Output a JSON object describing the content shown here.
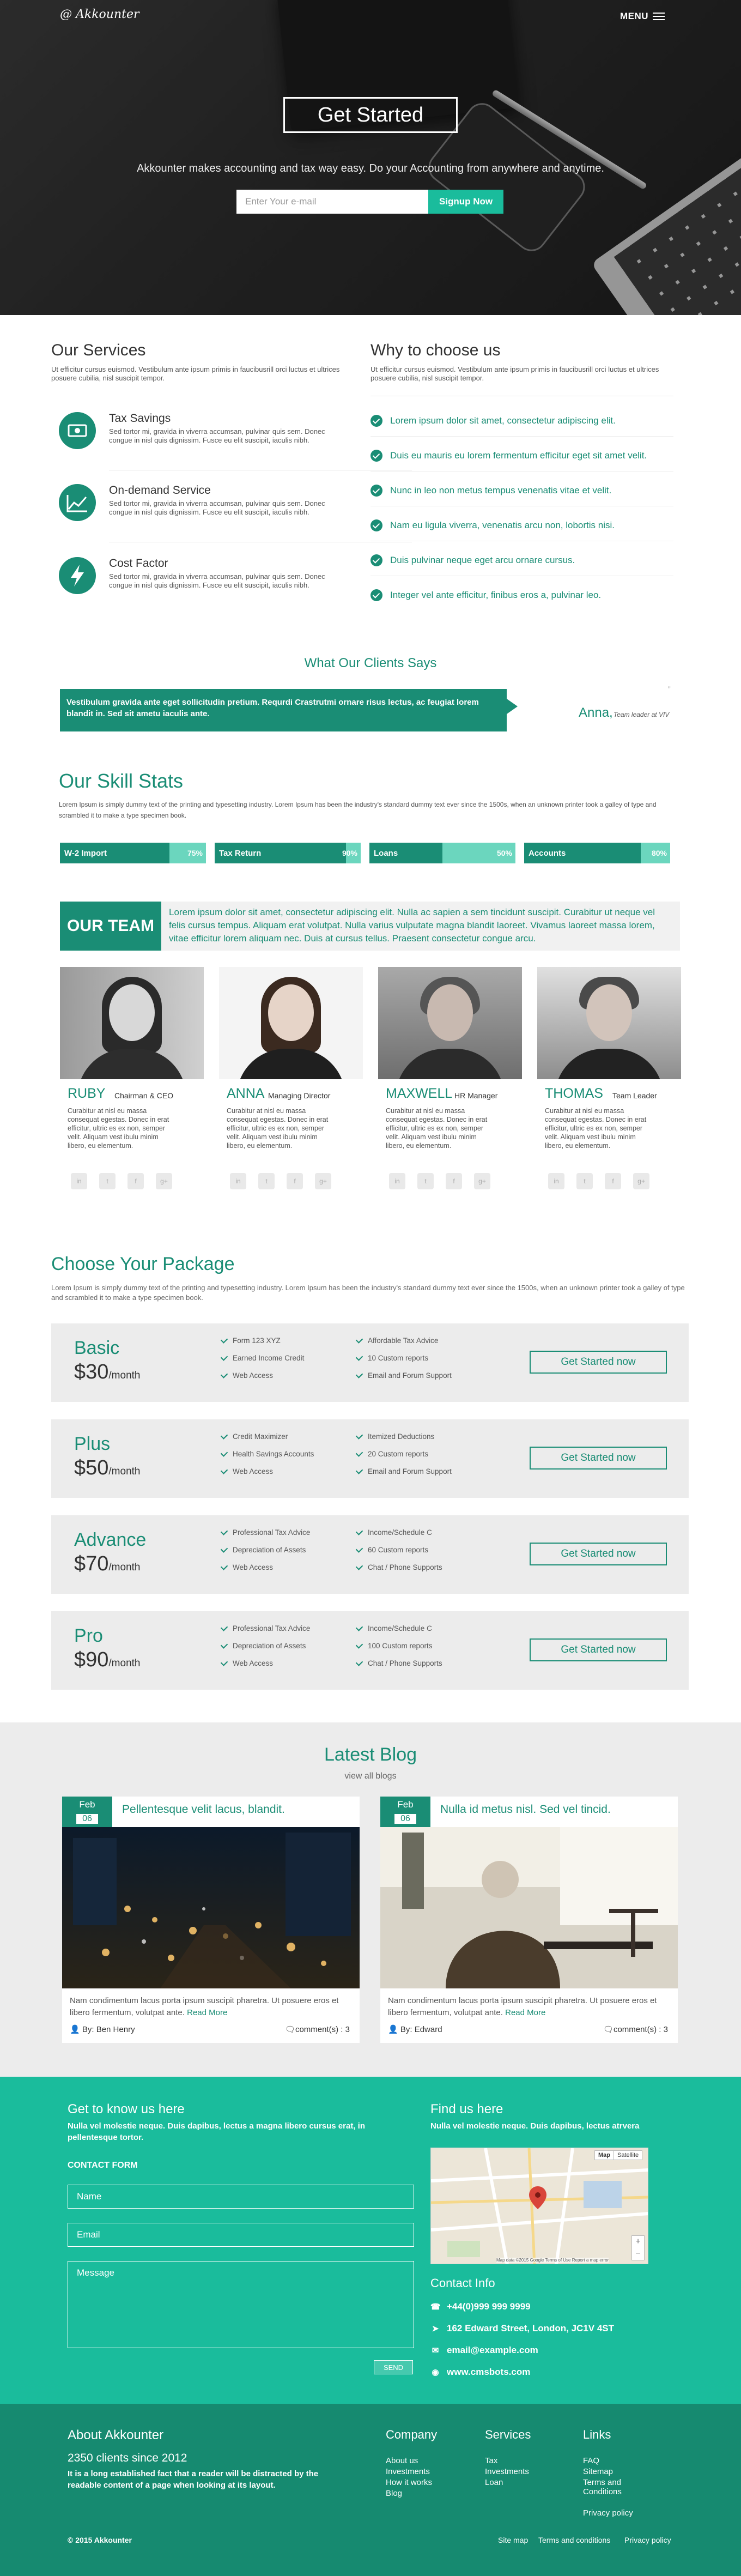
{
  "header": {
    "logo": "@ Akkounter",
    "menu_label": "MENU"
  },
  "hero": {
    "cta_label": "Get Started",
    "tagline": "Akkounter makes accounting and tax way easy. Do your Accounting from anywhere and anytime.",
    "email_placeholder": "Enter Your e-mail",
    "signup_label": "Signup Now"
  },
  "services": {
    "title": "Our Services",
    "intro": "Ut efficitur cursus euismod. Vestibulum ante ipsum primis in faucibusrill orci luctus et ultrices posuere cubilia, nisl suscipit tempor.",
    "items": [
      {
        "title": "Tax Savings",
        "icon": "money-icon",
        "text": "Sed tortor mi, gravida in viverra accumsan, pulvinar quis sem. Donec congue in nisl quis dignissim. Fusce eu elit suscipit, iaculis nibh."
      },
      {
        "title": "On-demand Service",
        "icon": "trend-chart-icon",
        "text": "Sed tortor mi, gravida in viverra accumsan, pulvinar quis sem. Donec congue in nisl quis dignissim. Fusce eu elit suscipit, iaculis nibh."
      },
      {
        "title": "Cost Factor",
        "icon": "lightning-icon",
        "text": "Sed tortor mi, gravida in viverra accumsan, pulvinar quis sem. Donec congue in nisl quis dignissim. Fusce eu elit suscipit, iaculis nibh."
      }
    ]
  },
  "why": {
    "title": "Why to choose us",
    "intro": "Ut efficitur cursus euismod. Vestibulum ante ipsum primis in faucibusrill orci luctus et ultrices posuere cubilia, nisl suscipit tempor.",
    "items": [
      "Lorem ipsum dolor sit amet, consectetur adipiscing elit.",
      "Duis eu mauris eu lorem fermentum efficitur eget sit amet velit.",
      "Nunc in leo non metus tempus venenatis vitae et velit.",
      "Nam eu ligula viverra, venenatis arcu non, lobortis nisi.",
      "Duis pulvinar neque eget arcu ornare cursus.",
      "Integer vel ante efficitur, finibus eros a, pulvinar leo."
    ]
  },
  "testimonial": {
    "title": "What Our Clients Says",
    "quote": "Vestibulum gravida ante eget sollicitudin pretium. Requrdi Crastrutmi ornare risus lectus, ac feugiat lorem blandit in. Sed sit ametu iaculis ante.",
    "name": "Anna,",
    "role": "Team leader at VIV",
    "quote_mark": "”"
  },
  "skills": {
    "title": "Our Skill Stats",
    "desc": "Lorem Ipsum is simply dummy text of the printing and typesetting industry. Lorem Ipsum has been the industry's standard dummy text ever since the 1500s, when an unknown printer took a galley of type and scrambled it to make a type specimen book.",
    "items": [
      {
        "label": "W-2 Import",
        "pct_label": "75%",
        "value": 0.75
      },
      {
        "label": "Tax Return",
        "pct_label": "90%",
        "value": 0.9
      },
      {
        "label": "Loans",
        "pct_label": "50%",
        "value": 0.5
      },
      {
        "label": "Accounts",
        "pct_label": "80%",
        "value": 0.8
      }
    ]
  },
  "team": {
    "badge": "OUR TEAM",
    "intro": "Lorem ipsum dolor sit amet, consectetur adipiscing elit. Nulla ac sapien a sem tincidunt suscipit. Curabitur ut neque vel felis cursus tempus. Aliquam erat volutpat. Nulla varius vulputate magna blandit laoreet. Vivamus laoreet massa lorem, vitae efficitur lorem aliquam nec. Duis at cursus tellus. Praesent consectetur congue arcu.",
    "members": [
      {
        "name": "RUBY",
        "role": "Chairman & CEO",
        "text": "Curabitur at nisl eu massa consequat egestas. Donec in erat efficitur, ultric es ex non, semper velit. Aliquam vest ibulu minim libero, eu elementum."
      },
      {
        "name": "ANNA",
        "role": "Managing Director",
        "text": "Curabitur at nisl eu massa consequat egestas. Donec in erat efficitur, ultric es ex non, semper velit. Aliquam vest ibulu minim libero, eu elementum."
      },
      {
        "name": "MAXWELL",
        "role": "HR Manager",
        "text": "Curabitur at nisl eu massa consequat egestas. Donec in erat efficitur, ultric es ex non, semper velit. Aliquam vest ibulu minim libero, eu elementum."
      },
      {
        "name": "THOMAS",
        "role": "Team Leader",
        "text": "Curabitur at nisl eu massa consequat egestas. Donec in erat efficitur, ultric es ex non, semper velit. Aliquam vest ibulu minim libero, eu elementum."
      }
    ],
    "social_icons": [
      "in",
      "t",
      "f",
      "g+"
    ]
  },
  "packages": {
    "title": "Choose Your Package",
    "desc": "Lorem Ipsum is simply dummy text of the printing and typesetting industry. Lorem Ipsum has been the industry's standard dummy text ever since the 1500s, when an unknown printer took a galley of type and scrambled it to make a type specimen book.",
    "button_label": "Get Started now",
    "plans": [
      {
        "name": "Basic",
        "price": "$30",
        "period": "/month",
        "features": [
          "Form 123 XYZ",
          "Earned Income Credit",
          "Web Access",
          "Affordable Tax Advice",
          "10 Custom reports",
          "Email and Forum Support"
        ]
      },
      {
        "name": "Plus",
        "price": "$50",
        "period": "/month",
        "features": [
          "Credit Maximizer",
          "Health Savings Accounts",
          "Web Access",
          "Itemized Deductions",
          "20 Custom reports",
          "Email and Forum Support"
        ]
      },
      {
        "name": "Advance",
        "price": "$70",
        "period": "/month",
        "features": [
          "Professional Tax Advice",
          "Depreciation of Assets",
          "Web Access",
          "Income/Schedule C",
          "60 Custom reports",
          "Chat / Phone Supports"
        ]
      },
      {
        "name": "Pro",
        "price": "$90",
        "period": "/month",
        "features": [
          "Professional Tax Advice",
          "Depreciation of Assets",
          "Web Access",
          "Income/Schedule C",
          "100 Custom reports",
          "Chat / Phone Supports"
        ]
      }
    ]
  },
  "blog": {
    "title": "Latest Blog",
    "subtitle": "view all blogs",
    "posts": [
      {
        "month": "Feb",
        "day": "06",
        "title": "Pellentesque velit lacus, blandit.",
        "text": "Nam condimentum lacus porta ipsum suscipit pharetra. Ut posuere eros et libero fermentum, volutpat ante.",
        "more": "Read More",
        "author": "By: Ben Henry",
        "comments": "comment(s) : 3"
      },
      {
        "month": "Feb",
        "day": "06",
        "title": "Nulla id metus nisl. Sed vel tincid.",
        "text": "Nam condimentum lacus porta ipsum suscipit pharetra. Ut posuere eros et libero fermentum, volutpat ante.",
        "more": "Read More",
        "author": "By: Edward",
        "comments": "comment(s) : 3"
      }
    ]
  },
  "contact": {
    "title": "Get to know us here",
    "intro": "Nulla vel molestie neque. Duis dapibus, lectus a magna libero cursus erat, in pellentesque tortor.",
    "form_label": "CONTACT FORM",
    "name_placeholder": "Name",
    "email_placeholder": "Email",
    "message_placeholder": "Message",
    "send_label": "SEND",
    "find_title": "Find us here",
    "find_intro": "Nulla vel molestie neque. Duis dapibus, lectus atrvera",
    "map_tabs": [
      "Map",
      "Satellite"
    ],
    "map_footer": "Map data ©2015 Google    Terms of Use    Report a map error",
    "info_title": "Contact Info",
    "info": [
      {
        "icon": "phone-icon",
        "glyph": "☎",
        "text": "+44(0)999 999 9999"
      },
      {
        "icon": "location-icon",
        "glyph": "➤",
        "text": "162 Edward Street, London, JC1V 4ST"
      },
      {
        "icon": "mail-icon",
        "glyph": "✉",
        "text": "email@example.com"
      },
      {
        "icon": "globe-icon",
        "glyph": "◉",
        "text": "www.cmsbots.com"
      }
    ]
  },
  "footer": {
    "about_title": "About Akkounter",
    "since": "2350 clients since 2012",
    "about_text": "It is a long established fact that a reader will be distracted by the readable content of a page when looking at its layout.",
    "company_title": "Company",
    "company_links": [
      "About us",
      "Investments",
      "How it works",
      "Blog"
    ],
    "services_title": "Services",
    "services_links": [
      "Tax",
      "Investments",
      "Loan"
    ],
    "links_title": "Links",
    "links_links": [
      "FAQ",
      "Sitemap",
      "Terms and Conditions",
      "Privacy policy"
    ],
    "copyright": "© 2015 Akkounter",
    "bottom_links": [
      "Site map",
      "Terms and conditions",
      "Privacy policy"
    ]
  },
  "colors": {
    "accent": "#1a8d75",
    "accent_light": "#1abc9c",
    "footer": "#168a70"
  }
}
